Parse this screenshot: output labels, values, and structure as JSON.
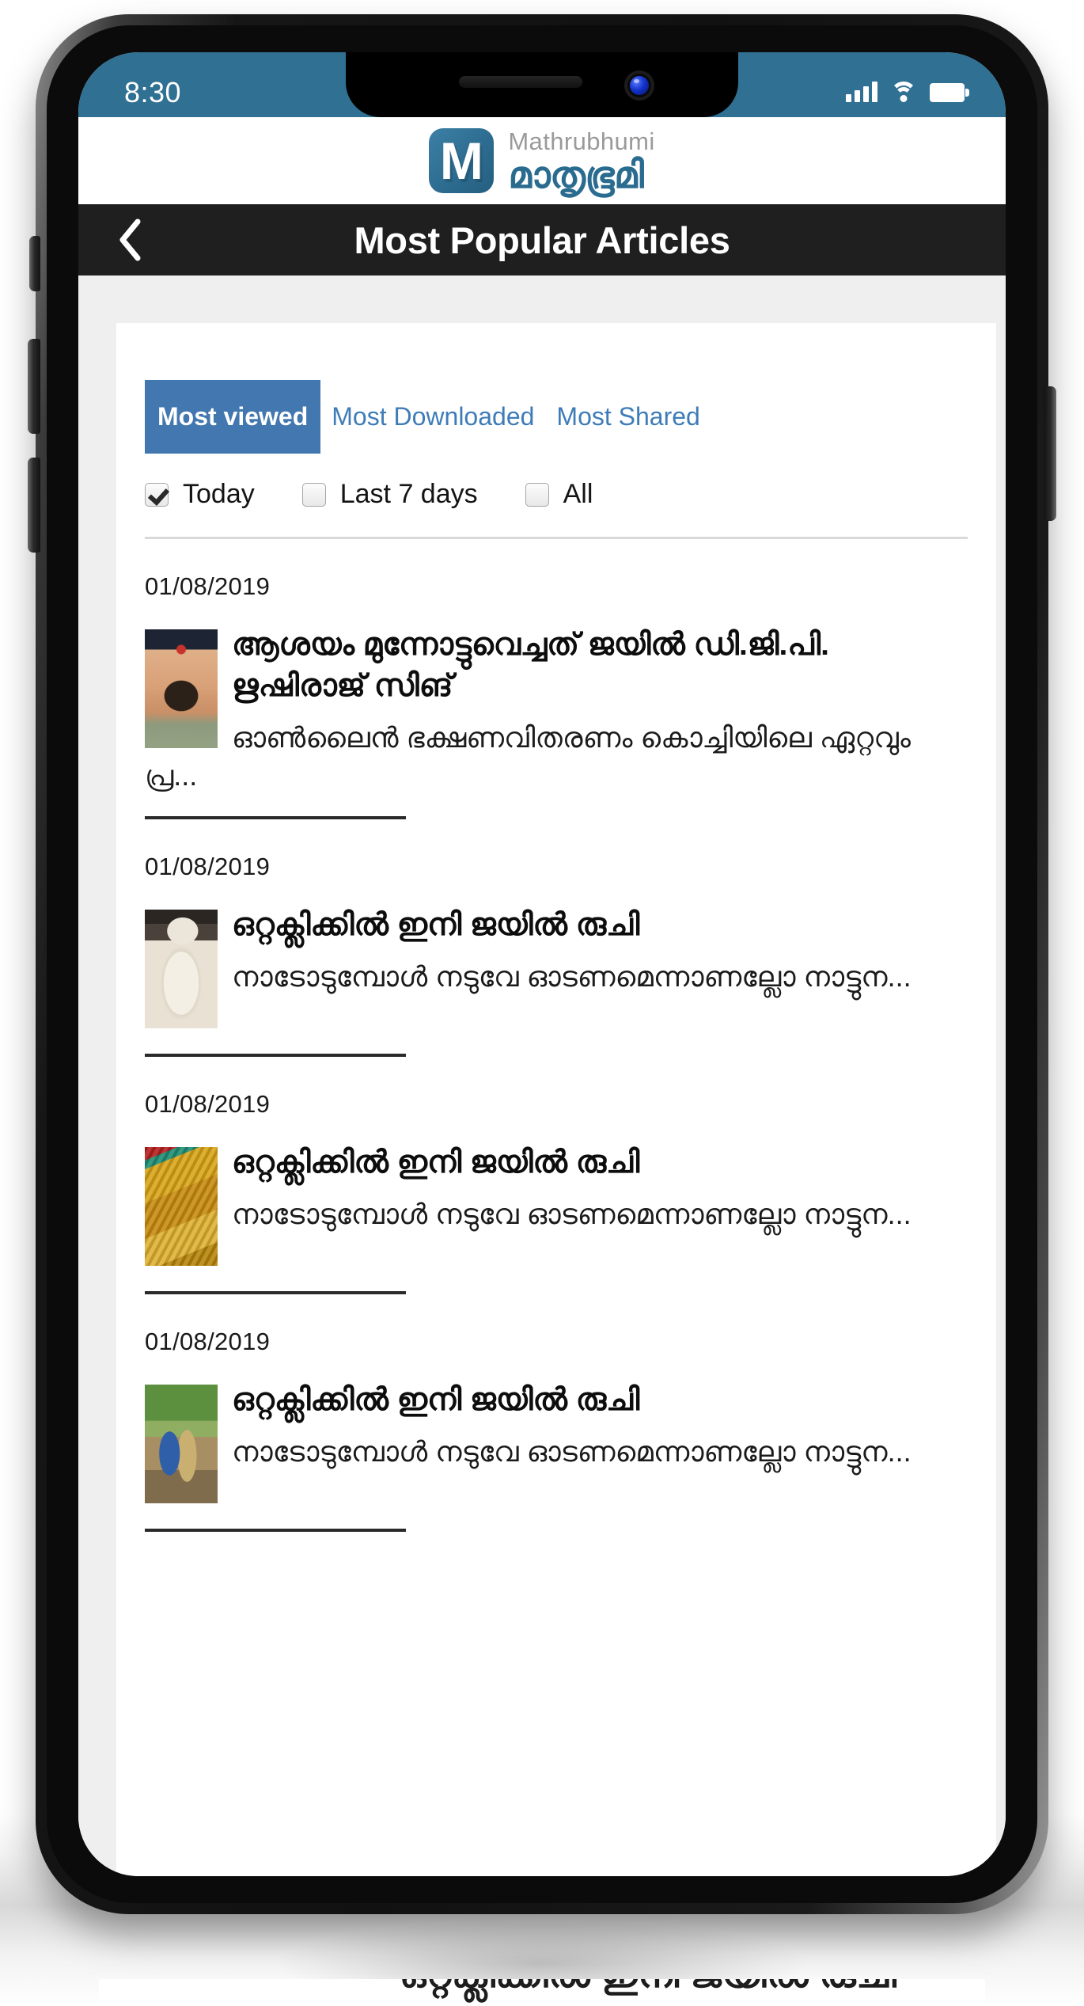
{
  "status_bar": {
    "time": "8:30",
    "icons": [
      "signal-icon",
      "wifi-icon",
      "battery-icon"
    ],
    "background_color": "#2f7093"
  },
  "brand": {
    "logo_letter": "M",
    "latin_name": "Mathrubhumi",
    "malayalam_name": "മാതൃഭൂമി",
    "logo_color": "#2a6c90",
    "latin_color": "#9a9a9a"
  },
  "titlebar": {
    "back_label": "‹",
    "title": "Most Popular Articles",
    "background_color": "#1f1f1f"
  },
  "tabs": {
    "active_index": 0,
    "active_color": "#4277b0",
    "link_color": "#3e7cb8",
    "items": [
      {
        "label": "Most viewed",
        "active": true
      },
      {
        "label": "Most Downloaded",
        "active": false
      },
      {
        "label": "Most Shared",
        "active": false
      }
    ]
  },
  "filters": [
    {
      "label": "Today",
      "checked": true
    },
    {
      "label": "Last 7 days",
      "checked": false
    },
    {
      "label": "All",
      "checked": false
    }
  ],
  "articles": [
    {
      "date": "01/08/2019",
      "title": "ആശയം മുന്നോട്ടുവെച്ചത് ജയിൽ ഡി.ജി.പി. ഋഷിരാജ് സിങ്",
      "excerpt": "ഓൺലൈൻ ഭക്ഷണവിതരണം കൊച്ചിയിലെ ഏറ്റവും പ്ര...",
      "thumbnail": "police-officer-portrait"
    },
    {
      "date": "01/08/2019",
      "title": "ഒറ്റക്ലിക്കിൽ ഇനി ജയിൽ രുചി",
      "excerpt": "നാടോടുമ്പോൾ നടുവേ ഓടണമെന്നാണല്ലോ നാട്ടുന...",
      "thumbnail": "white-food-dish"
    },
    {
      "date": "01/08/2019",
      "title": "ഒറ്റക്ലിക്കിൽ ഇനി ജയിൽ രുചി",
      "excerpt": "നാടോടുമ്പോൾ നടുവേ ഓടണമെന്നാണല്ലോ നാട്ടുന...",
      "thumbnail": "gold-jewellery"
    },
    {
      "date": "01/08/2019",
      "title": "ഒറ്റക്ലിക്കിൽ ഇനി ജയിൽ രുചി",
      "excerpt": "നാടോടുമ്പോൾ നടുവേ ഓടണമെന്നാണല്ലോ നാട്ടുന...",
      "thumbnail": "outdoor-police-scene"
    }
  ],
  "below_fold": {
    "clipped_text": "ഒറ്റക്ലിക്കിൽ ഇനി ജയിൽ രുചി"
  },
  "page_background": "#efefef",
  "card_background": "#ffffff"
}
